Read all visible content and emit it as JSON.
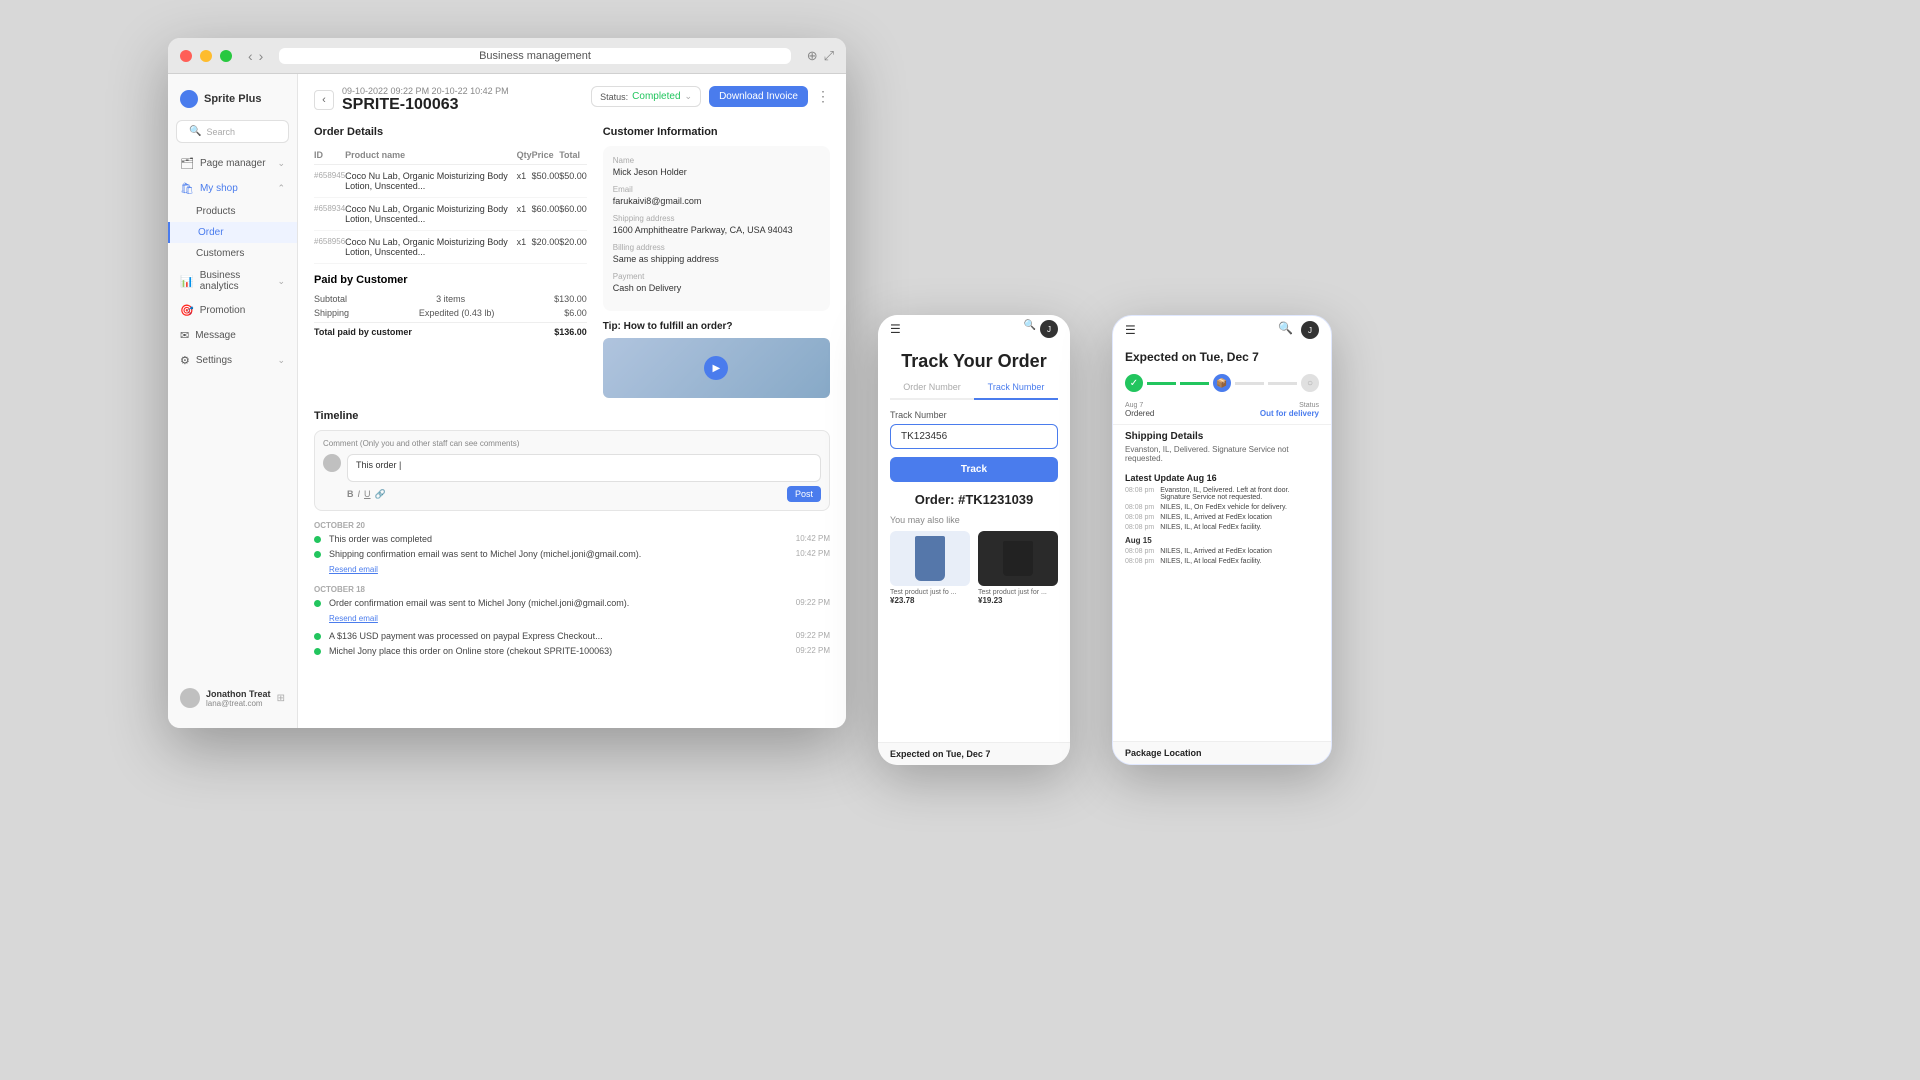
{
  "browser": {
    "address": "Business management",
    "window_title": "Business Management"
  },
  "sidebar": {
    "logo_text": "Sprite Plus",
    "search_placeholder": "Search",
    "nav_items": [
      {
        "id": "page-manager",
        "label": "Page manager",
        "icon": "⚟",
        "has_arrow": true
      },
      {
        "id": "my-shop",
        "label": "My shop",
        "icon": "🛍",
        "has_arrow": true,
        "active": true
      }
    ],
    "sub_items": [
      {
        "id": "products",
        "label": "Products"
      },
      {
        "id": "order",
        "label": "Order",
        "active": true
      },
      {
        "id": "customers",
        "label": "Customers"
      }
    ],
    "bottom_nav": [
      {
        "id": "business-analytics",
        "label": "Business analytics",
        "icon": "📊"
      },
      {
        "id": "promotion",
        "label": "Promotion",
        "icon": "🎯"
      },
      {
        "id": "message",
        "label": "Message",
        "icon": "✉"
      },
      {
        "id": "settings",
        "label": "Settings",
        "icon": "⚙"
      }
    ],
    "user": {
      "name": "Jonathon Treat",
      "email": "lana@treat.com"
    }
  },
  "order": {
    "date_range": "09-10-2022 09:22 PM  20-10-22 10:42 PM",
    "id": "SPRITE-100063",
    "status": "Completed",
    "status_color": "#22c55e",
    "download_btn_label": "Download Invoice",
    "sections": {
      "order_details_title": "Order Details",
      "table_headers": [
        "ID",
        "Product name",
        "Qty",
        "Price",
        "Total"
      ],
      "products": [
        {
          "id": "#658945",
          "name": "Coco Nu Lab, Organic Moisturizing Body Lotion, Unscented...",
          "qty": "x1",
          "price": "$50.00",
          "total": "$50.00"
        },
        {
          "id": "#658934",
          "name": "Coco Nu Lab, Organic Moisturizing Body Lotion, Unscented...",
          "qty": "x1",
          "price": "$60.00",
          "total": "$60.00"
        },
        {
          "id": "#658956",
          "name": "Coco Nu Lab, Organic Moisturizing Body Lotion, Unscented...",
          "qty": "x1",
          "price": "$20.00",
          "total": "$20.00"
        }
      ],
      "paid_title": "Paid by Customer",
      "subtotal_label": "Subtotal",
      "subtotal_items": "3 items",
      "subtotal_value": "$130.00",
      "shipping_label": "Shipping",
      "shipping_detail": "Expedited (0.43 lb)",
      "shipping_value": "$6.00",
      "total_label": "Total paid by customer",
      "total_value": "$136.00"
    },
    "customer": {
      "title": "Customer Information",
      "name_label": "Name",
      "name_value": "Mick Jeson Holder",
      "email_label": "Email",
      "email_value": "farukaivi8@gmail.com",
      "shipping_label": "Shipping address",
      "shipping_value": "1600 Amphitheatre Parkway, CA, USA 94043",
      "billing_label": "Billing address",
      "billing_value": "Same as shipping address",
      "payment_label": "Payment",
      "payment_value": "Cash on Delivery"
    },
    "tip": {
      "title": "Tip: How to fulfill an order?"
    },
    "timeline": {
      "title": "Timeline",
      "comment_label": "Comment (Only you and other staff can see comments)",
      "comment_placeholder": "This order |",
      "post_label": "Post",
      "groups": [
        {
          "date": "OCTOBER 20",
          "items": [
            {
              "text": "This order was completed",
              "time": "10:42 PM"
            },
            {
              "text": "Shipping confirmation email was sent to Michel Jony (michel.joni@gmail.com).",
              "time": "10:42 PM",
              "action": "Resend email"
            }
          ]
        },
        {
          "date": "OCTOBER 18",
          "items": [
            {
              "text": "Order confirmation email was sent to Michel Jony (michel.joni@gmail.com).",
              "time": "09:22 PM",
              "action": "Resend email"
            },
            {
              "text": "A $136 USD payment was processed on paypal Express Checkout...",
              "time": "09:22 PM"
            },
            {
              "text": "Michel Jony place this order on Online store (chekout SPRITE-100063)",
              "time": "09:22 PM"
            }
          ]
        }
      ]
    }
  },
  "phone1": {
    "title": "Track Your Order",
    "tabs": [
      {
        "id": "order-number",
        "label": "Order Number"
      },
      {
        "id": "track-number",
        "label": "Track Number",
        "active": true
      }
    ],
    "track_field_label": "Track Number",
    "track_input_value": "TK123456",
    "track_btn_label": "Track",
    "order_number_label": "Order:",
    "order_number_value": "#TK1231039",
    "may_like": "You may also like",
    "products": [
      {
        "name": "Test product just fo ...",
        "price": "¥23.78",
        "color": "blue"
      },
      {
        "name": "Test product just for ...",
        "price": "¥19.23",
        "color": "dark"
      }
    ],
    "expected_label": "Expected on Tue, Dec 7"
  },
  "phone2": {
    "expected_title": "Expected on Tue, Dec 7",
    "progress_steps": [
      {
        "label": "Aug 7",
        "sublabel": "Ordered",
        "state": "done"
      },
      {
        "label": "",
        "sublabel": "",
        "state": "active"
      },
      {
        "label": "",
        "sublabel": "",
        "state": "pending"
      },
      {
        "label": "",
        "sublabel": "",
        "state": "pending"
      }
    ],
    "status_label": "Status",
    "status_value": "Out for delivery",
    "ordered_date": "Aug 7",
    "ordered_label": "Ordered",
    "shipping_details_title": "Shipping Details",
    "shipping_details_text": "Evanston, IL, Delivered. Signature Service not requested.",
    "latest_update_title": "Latest Update Aug 16",
    "updates": [
      {
        "time": "08:08 pm",
        "text": "Evanston, IL, Delivered. Left at front door. Signature Service not requested."
      },
      {
        "time": "08:08 pm",
        "text": "NILES, IL, On FedEx vehicle for delivery."
      },
      {
        "time": "08:08 pm",
        "text": "NILES, IL, Arrived at FedEx location"
      },
      {
        "time": "08:08 pm",
        "text": "NILES, IL, At local FedEx facility."
      }
    ],
    "aug15_label": "Aug 15",
    "aug15_updates": [
      {
        "time": "08:08 pm",
        "text": "NILES, IL, Arrived at FedEx location"
      },
      {
        "time": "08:08 pm",
        "text": "NILES, IL, At local FedEx facility."
      }
    ],
    "package_location_title": "Package Location"
  }
}
